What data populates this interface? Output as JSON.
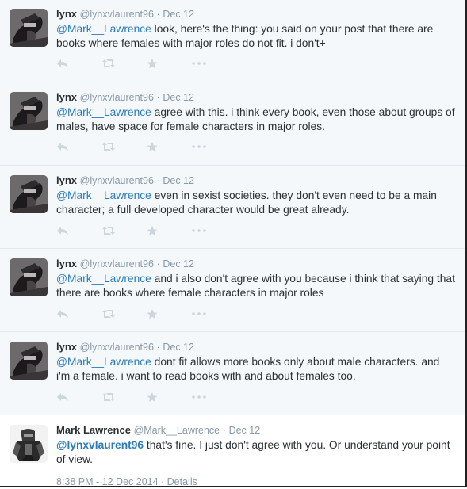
{
  "tweets": [
    {
      "name": "lynx",
      "handle": "@lynxvlaurent96",
      "separator": "·",
      "date": "Dec 12",
      "mention": "@Mark__Lawrence",
      "text": " look, here's the thing: you said on your post that there are books where females with major roles do not fit. i don't+",
      "avatar": "masked-figure-avatar"
    },
    {
      "name": "lynx",
      "handle": "@lynxvlaurent96",
      "separator": "·",
      "date": "Dec 12",
      "mention": "@Mark__Lawrence",
      "text": " agree with this. i think every book, even those about groups of males, have space for female characters in major roles.",
      "avatar": "masked-figure-avatar"
    },
    {
      "name": "lynx",
      "handle": "@lynxvlaurent96",
      "separator": "·",
      "date": "Dec 12",
      "mention": "@Mark__Lawrence",
      "text": " even in sexist societies. they don't even need to be a main character; a full developed character would be great already.",
      "avatar": "masked-figure-avatar"
    },
    {
      "name": "lynx",
      "handle": "@lynxvlaurent96",
      "separator": "·",
      "date": "Dec 12",
      "mention": "@Mark__Lawrence",
      "text": " and i also don't agree with you because i think that saying that there are books where female characters in major roles",
      "avatar": "masked-figure-avatar"
    },
    {
      "name": "lynx",
      "handle": "@lynxvlaurent96",
      "separator": "·",
      "date": "Dec 12",
      "mention": "@Mark__Lawrence",
      "text": " dont fit allows more books only about male characters. and i'm a female. i want to read books with and about females too.",
      "avatar": "masked-figure-avatar"
    }
  ],
  "focused_tweet": {
    "name": "Mark Lawrence",
    "handle": "@Mark__Lawrence",
    "separator": "·",
    "date": "Dec 12",
    "mention": "@lynxvlaurent96",
    "text": " that's fine. I just don't agree with you. Or understand your point of view.",
    "footer": "8:38 PM - 12 Dec 2014 · Details",
    "avatar": "armored-figure-avatar"
  },
  "actions": {
    "reply": "reply-icon",
    "retweet": "retweet-icon",
    "favorite": "favorite-star-icon",
    "more": "more-options-icon"
  },
  "colors": {
    "link": "#2b7bb9",
    "meta": "#8899a6",
    "reply_bg": "#f5f8fa",
    "action_icon": "#ccd6dd"
  }
}
